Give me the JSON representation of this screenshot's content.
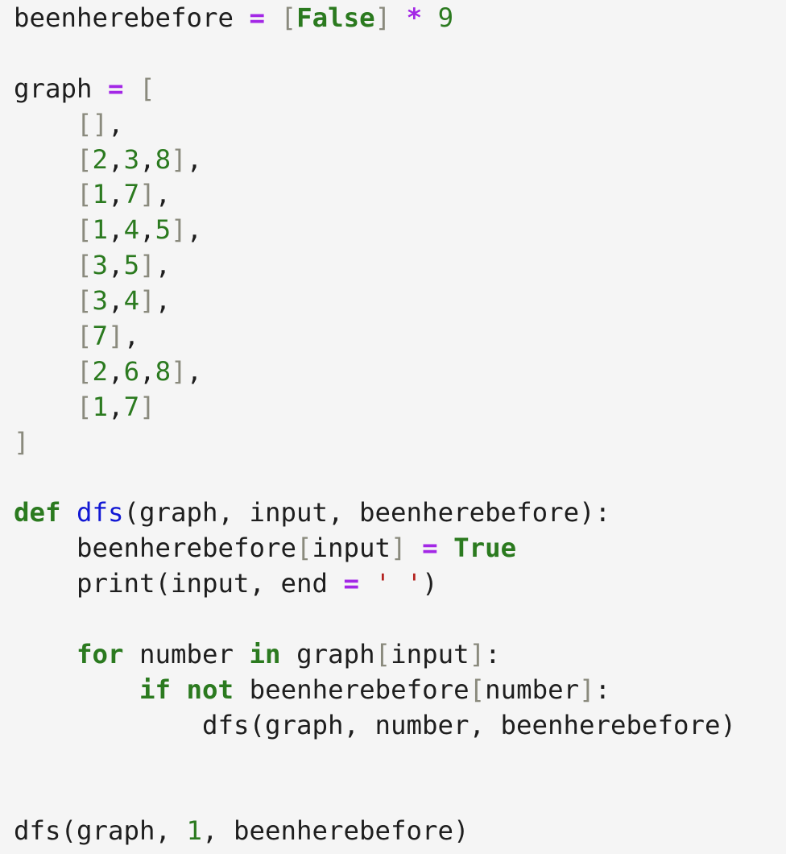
{
  "editor": {
    "lines": [
      [
        {
          "t": "beenherebefore ",
          "c": "txt"
        },
        {
          "t": "=",
          "c": "op"
        },
        {
          "t": " ",
          "c": "txt"
        },
        {
          "t": "[",
          "c": "br"
        },
        {
          "t": "False",
          "c": "kw"
        },
        {
          "t": "]",
          "c": "br"
        },
        {
          "t": " ",
          "c": "txt"
        },
        {
          "t": "*",
          "c": "op"
        },
        {
          "t": " ",
          "c": "txt"
        },
        {
          "t": "9",
          "c": "num"
        }
      ],
      [],
      [
        {
          "t": "graph ",
          "c": "txt"
        },
        {
          "t": "=",
          "c": "op"
        },
        {
          "t": " ",
          "c": "txt"
        },
        {
          "t": "[",
          "c": "br"
        }
      ],
      [
        {
          "t": "    ",
          "c": "txt"
        },
        {
          "t": "[]",
          "c": "br"
        },
        {
          "t": ",",
          "c": "txt"
        }
      ],
      [
        {
          "t": "    ",
          "c": "txt"
        },
        {
          "t": "[",
          "c": "br"
        },
        {
          "t": "2",
          "c": "num"
        },
        {
          "t": ",",
          "c": "txt"
        },
        {
          "t": "3",
          "c": "num"
        },
        {
          "t": ",",
          "c": "txt"
        },
        {
          "t": "8",
          "c": "num"
        },
        {
          "t": "]",
          "c": "br"
        },
        {
          "t": ",",
          "c": "txt"
        }
      ],
      [
        {
          "t": "    ",
          "c": "txt"
        },
        {
          "t": "[",
          "c": "br"
        },
        {
          "t": "1",
          "c": "num"
        },
        {
          "t": ",",
          "c": "txt"
        },
        {
          "t": "7",
          "c": "num"
        },
        {
          "t": "]",
          "c": "br"
        },
        {
          "t": ",",
          "c": "txt"
        }
      ],
      [
        {
          "t": "    ",
          "c": "txt"
        },
        {
          "t": "[",
          "c": "br"
        },
        {
          "t": "1",
          "c": "num"
        },
        {
          "t": ",",
          "c": "txt"
        },
        {
          "t": "4",
          "c": "num"
        },
        {
          "t": ",",
          "c": "txt"
        },
        {
          "t": "5",
          "c": "num"
        },
        {
          "t": "]",
          "c": "br"
        },
        {
          "t": ",",
          "c": "txt"
        }
      ],
      [
        {
          "t": "    ",
          "c": "txt"
        },
        {
          "t": "[",
          "c": "br"
        },
        {
          "t": "3",
          "c": "num"
        },
        {
          "t": ",",
          "c": "txt"
        },
        {
          "t": "5",
          "c": "num"
        },
        {
          "t": "]",
          "c": "br"
        },
        {
          "t": ",",
          "c": "txt"
        }
      ],
      [
        {
          "t": "    ",
          "c": "txt"
        },
        {
          "t": "[",
          "c": "br"
        },
        {
          "t": "3",
          "c": "num"
        },
        {
          "t": ",",
          "c": "txt"
        },
        {
          "t": "4",
          "c": "num"
        },
        {
          "t": "]",
          "c": "br"
        },
        {
          "t": ",",
          "c": "txt"
        }
      ],
      [
        {
          "t": "    ",
          "c": "txt"
        },
        {
          "t": "[",
          "c": "br"
        },
        {
          "t": "7",
          "c": "num"
        },
        {
          "t": "]",
          "c": "br"
        },
        {
          "t": ",",
          "c": "txt"
        }
      ],
      [
        {
          "t": "    ",
          "c": "txt"
        },
        {
          "t": "[",
          "c": "br"
        },
        {
          "t": "2",
          "c": "num"
        },
        {
          "t": ",",
          "c": "txt"
        },
        {
          "t": "6",
          "c": "num"
        },
        {
          "t": ",",
          "c": "txt"
        },
        {
          "t": "8",
          "c": "num"
        },
        {
          "t": "]",
          "c": "br"
        },
        {
          "t": ",",
          "c": "txt"
        }
      ],
      [
        {
          "t": "    ",
          "c": "txt"
        },
        {
          "t": "[",
          "c": "br"
        },
        {
          "t": "1",
          "c": "num"
        },
        {
          "t": ",",
          "c": "txt"
        },
        {
          "t": "7",
          "c": "num"
        },
        {
          "t": "]",
          "c": "br"
        }
      ],
      [
        {
          "t": "]",
          "c": "br"
        }
      ],
      [],
      [
        {
          "t": "def",
          "c": "kw"
        },
        {
          "t": " ",
          "c": "txt"
        },
        {
          "t": "dfs",
          "c": "fn"
        },
        {
          "t": "(graph, input, beenherebefore):",
          "c": "txt"
        }
      ],
      [
        {
          "t": "    beenherebefore",
          "c": "txt"
        },
        {
          "t": "[",
          "c": "br"
        },
        {
          "t": "input",
          "c": "txt"
        },
        {
          "t": "]",
          "c": "br"
        },
        {
          "t": " ",
          "c": "txt"
        },
        {
          "t": "=",
          "c": "op"
        },
        {
          "t": " ",
          "c": "txt"
        },
        {
          "t": "True",
          "c": "kw"
        }
      ],
      [
        {
          "t": "    print(input, end ",
          "c": "txt"
        },
        {
          "t": "=",
          "c": "op"
        },
        {
          "t": " ",
          "c": "txt"
        },
        {
          "t": "' '",
          "c": "str"
        },
        {
          "t": ")",
          "c": "txt"
        }
      ],
      [],
      [
        {
          "t": "    ",
          "c": "txt"
        },
        {
          "t": "for",
          "c": "kw"
        },
        {
          "t": " number ",
          "c": "txt"
        },
        {
          "t": "in",
          "c": "kw"
        },
        {
          "t": " graph",
          "c": "txt"
        },
        {
          "t": "[",
          "c": "br"
        },
        {
          "t": "input",
          "c": "txt"
        },
        {
          "t": "]",
          "c": "br"
        },
        {
          "t": ":",
          "c": "txt"
        }
      ],
      [
        {
          "t": "        ",
          "c": "txt"
        },
        {
          "t": "if",
          "c": "kw"
        },
        {
          "t": " ",
          "c": "txt"
        },
        {
          "t": "not",
          "c": "kw"
        },
        {
          "t": " beenherebefore",
          "c": "txt"
        },
        {
          "t": "[",
          "c": "br"
        },
        {
          "t": "number",
          "c": "txt"
        },
        {
          "t": "]",
          "c": "br"
        },
        {
          "t": ":",
          "c": "txt"
        }
      ],
      [
        {
          "t": "            dfs(graph, number, beenherebefore)",
          "c": "txt"
        }
      ],
      [],
      [],
      [
        {
          "t": "dfs(graph, ",
          "c": "txt"
        },
        {
          "t": "1",
          "c": "num"
        },
        {
          "t": ", beenherebefore)",
          "c": "txt"
        }
      ]
    ]
  }
}
